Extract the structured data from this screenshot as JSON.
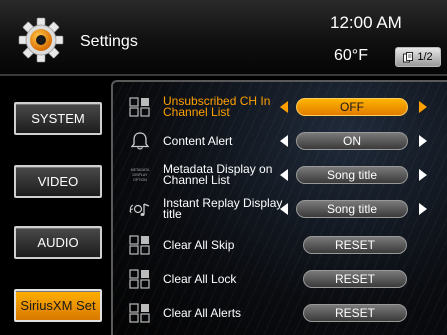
{
  "header": {
    "title": "Settings",
    "clock": "12:00 AM",
    "temperature": "60°F",
    "page": "1/2"
  },
  "sidebar": {
    "items": [
      {
        "label": "SYSTEM",
        "active": false
      },
      {
        "label": "VIDEO",
        "active": false
      },
      {
        "label": "AUDIO",
        "active": false
      },
      {
        "label": "SiriusXM Set",
        "active": true
      }
    ]
  },
  "settings": {
    "rows": [
      {
        "label": "Unsubscribed CH In Channel List",
        "value": "OFF",
        "icon": "channel-list-icon",
        "highlighted": true
      },
      {
        "label": "Content Alert",
        "value": "ON",
        "icon": "bell-icon",
        "highlighted": false
      },
      {
        "label": "Metadata Display on Channel List",
        "value": "Song title",
        "icon": "metadata-display-icon",
        "icon_text": "METADATA DISPLAY OPTION",
        "highlighted": false
      },
      {
        "label": "Instant Replay Display title",
        "value": "Song title",
        "icon": "music-note-icon",
        "highlighted": false
      },
      {
        "label": "Clear All Skip",
        "value": "RESET",
        "icon": "channel-list-icon",
        "highlighted": false
      },
      {
        "label": "Clear All Lock",
        "value": "RESET",
        "icon": "channel-list-icon",
        "highlighted": false
      },
      {
        "label": "Clear All Alerts",
        "value": "RESET",
        "icon": "channel-list-icon",
        "highlighted": false
      }
    ]
  },
  "colors": {
    "accent": "#ffa000",
    "background": "#000000",
    "text": "#ffffff"
  }
}
